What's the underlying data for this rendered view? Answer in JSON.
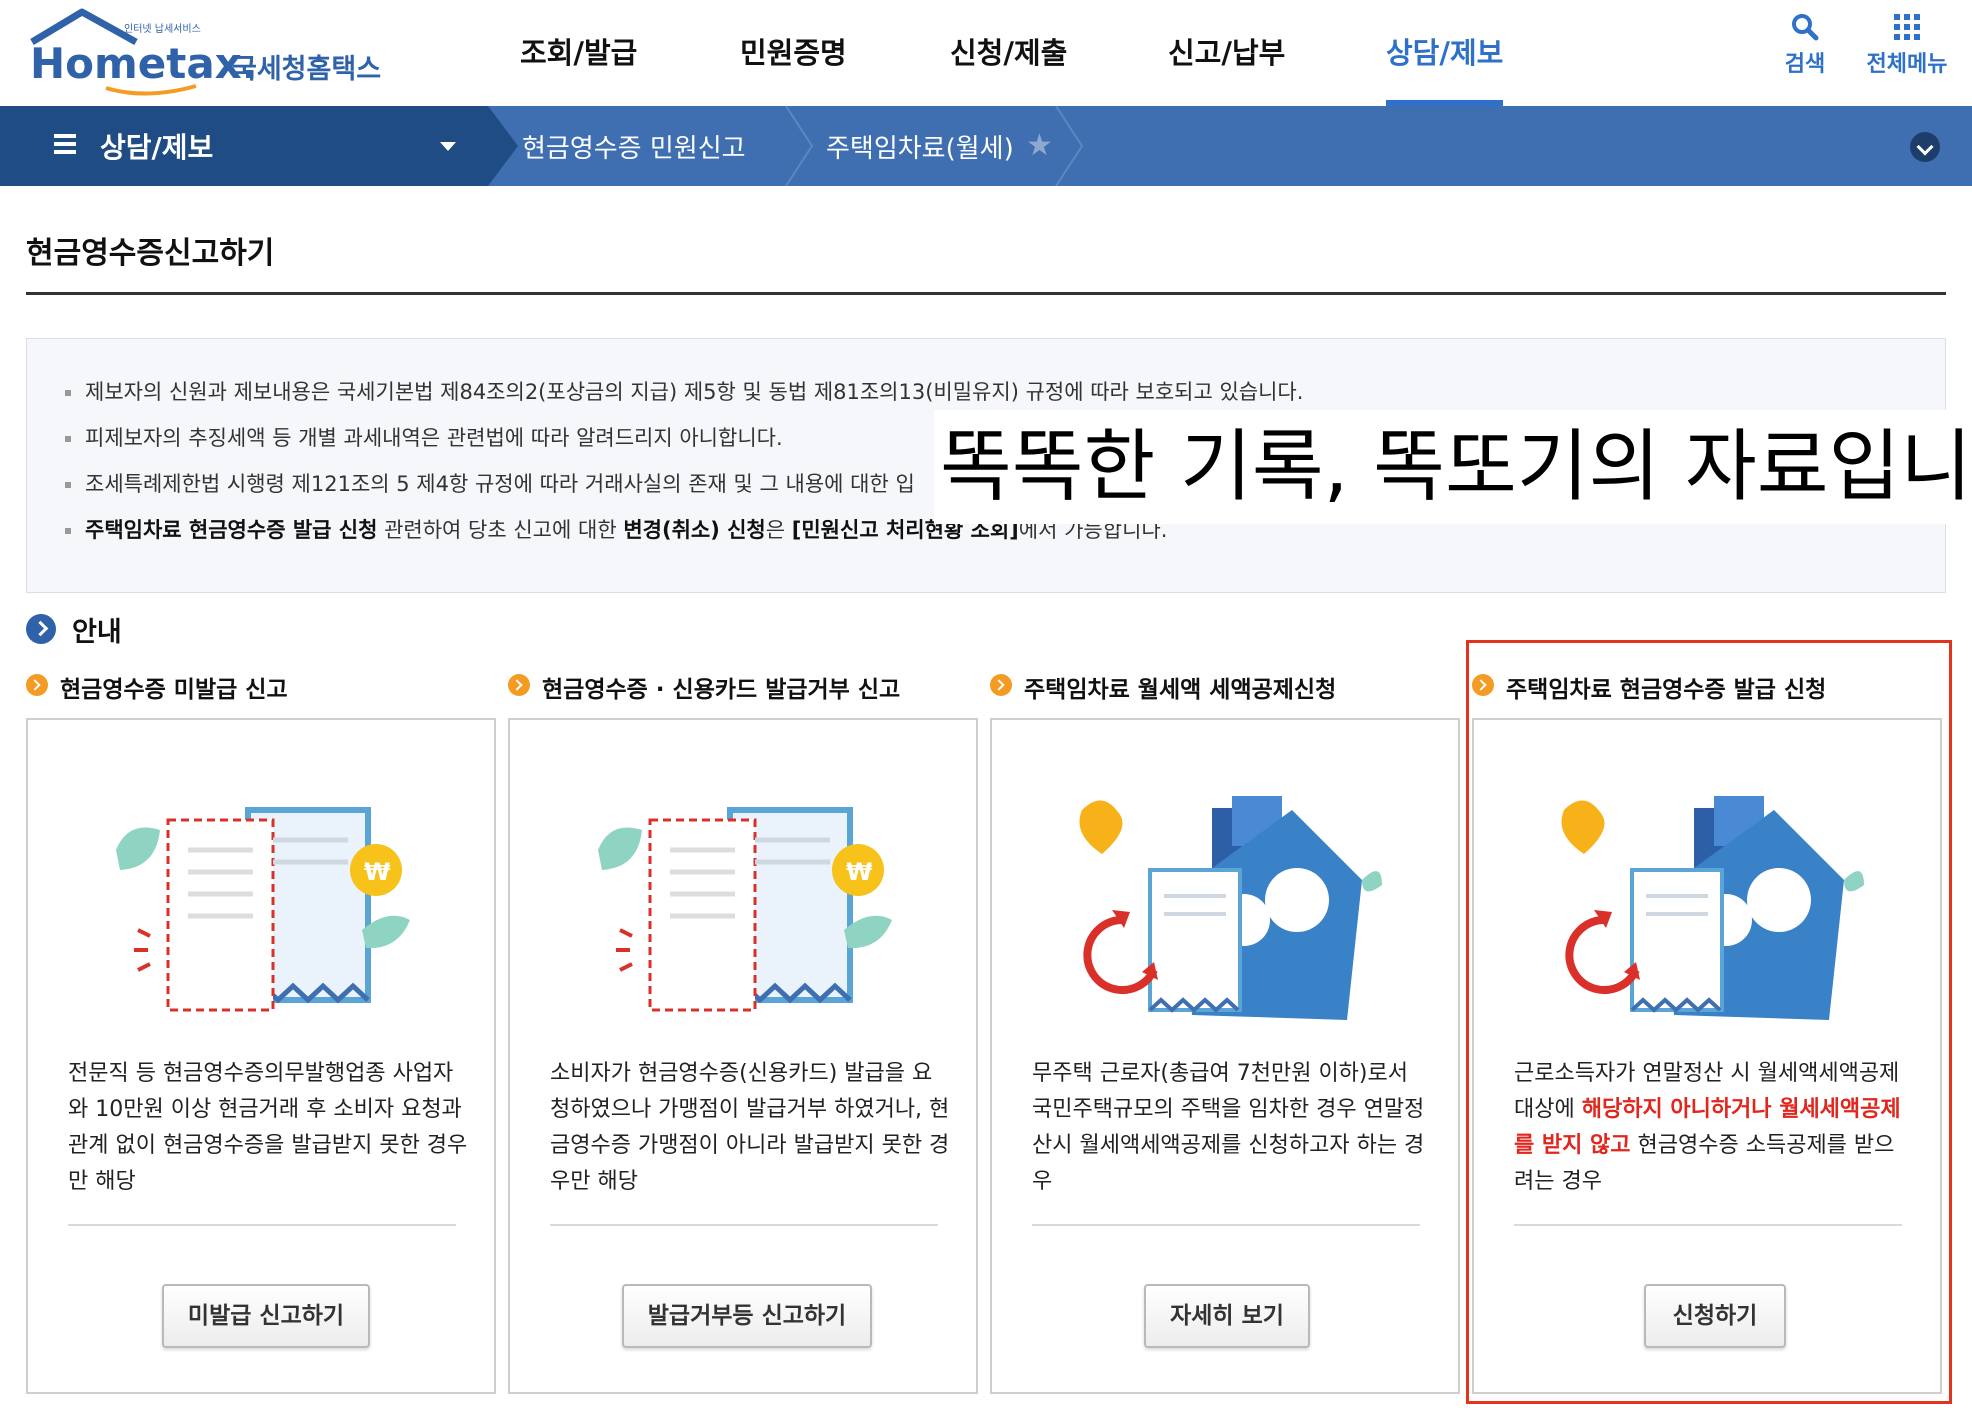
{
  "header": {
    "logo_small": "인터넷 납세서비스",
    "logo_main": "Hometax.",
    "logo_sub": "국세청홈택스",
    "nav": [
      {
        "label": "조회/발급",
        "active": false
      },
      {
        "label": "민원증명",
        "active": false
      },
      {
        "label": "신청/제출",
        "active": false
      },
      {
        "label": "신고/납부",
        "active": false
      },
      {
        "label": "상담/제보",
        "active": true
      }
    ],
    "search_label": "검색",
    "all_menu_label": "전체메뉴"
  },
  "subbar": {
    "section": "상담/제보",
    "crumbs": [
      "현금영수증 민원신고",
      "주택임차료(월세)"
    ]
  },
  "page_title": "현금영수증신고하기",
  "notices": [
    {
      "parts": [
        {
          "t": "제보자의 신원과 제보내용은 국세기본법 제84조의2(포상금의 지급) 제5항 및 동법 제81조의13(비밀유지) 규정에 따라 보호되고 있습니다.",
          "b": false
        }
      ]
    },
    {
      "parts": [
        {
          "t": "피제보자의 추징세액 등 개별 과세내역은 관련법에 따라 알려드리지 아니합니다.",
          "b": false
        }
      ]
    },
    {
      "parts": [
        {
          "t": "조세특례제한법 시행령 제121조의 5 제4항 규정에 따라 거래사실의 존재 및 그 내용에 대한 입",
          "b": false
        }
      ]
    },
    {
      "parts": [
        {
          "t": "주택임차료 현금영수증 발급 신청",
          "b": true
        },
        {
          "t": " 관련하여 당초 신고에 대한 ",
          "b": false
        },
        {
          "t": "변경(취소) 신청",
          "b": true
        },
        {
          "t": "은 ",
          "b": false
        },
        {
          "t": "[민원신고 처리현황 조회]",
          "b": true
        },
        {
          "t": "에서 가능합니다.",
          "b": false
        }
      ]
    }
  ],
  "overlay_text": "똑똑한 기록, 똑또기의 자료입니다",
  "guide_label": "안내",
  "cards": [
    {
      "title": "현금영수증 미발급 신고",
      "illus": "receipt",
      "desc": [
        {
          "t": "전문직 등 현금영수증의무발행업종 사업자와 10만원 이상 현금거래 후 소비자 요청과 관계 없이 현금영수증을 발급받지 못한 경우만 해당",
          "red": false
        }
      ],
      "button": "미발급 신고하기"
    },
    {
      "title": "현금영수증 · 신용카드 발급거부 신고",
      "illus": "receipt",
      "desc": [
        {
          "t": "소비자가 현금영수증(신용카드) 발급을 요청하였으나 가맹점이 발급거부 하였거나, 현금영수증 가맹점이 아니라 발급받지 못한 경우만 해당",
          "red": false
        }
      ],
      "button": "발급거부등 신고하기"
    },
    {
      "title": "주택임차료 월세액 세액공제신청",
      "illus": "house",
      "desc": [
        {
          "t": "무주택 근로자(총급여 7천만원 이하)로서 국민주택규모의 주택을 임차한 경우 연말정산시 월세액세액공제를 신청하고자 하는 경우",
          "red": false
        }
      ],
      "button": "자세히 보기"
    },
    {
      "title": "주택임차료 현금영수증 발급 신청",
      "illus": "house",
      "desc": [
        {
          "t": "근로소득자가 연말정산 시 월세액세액공제 대상에 ",
          "red": false
        },
        {
          "t": "해당하지 아니하거나 월세세액공제를 받지 않고",
          "red": true
        },
        {
          "t": " 현금영수증 소득공제를 받으려는 경우",
          "red": false
        }
      ],
      "button": "신청하기"
    }
  ],
  "colors": {
    "accent": "#2f71c9",
    "subbar": "#3f6fb0",
    "subbar_dark": "#1f4c85",
    "highlight": "#e3331f",
    "red_text": "#e0261d"
  }
}
